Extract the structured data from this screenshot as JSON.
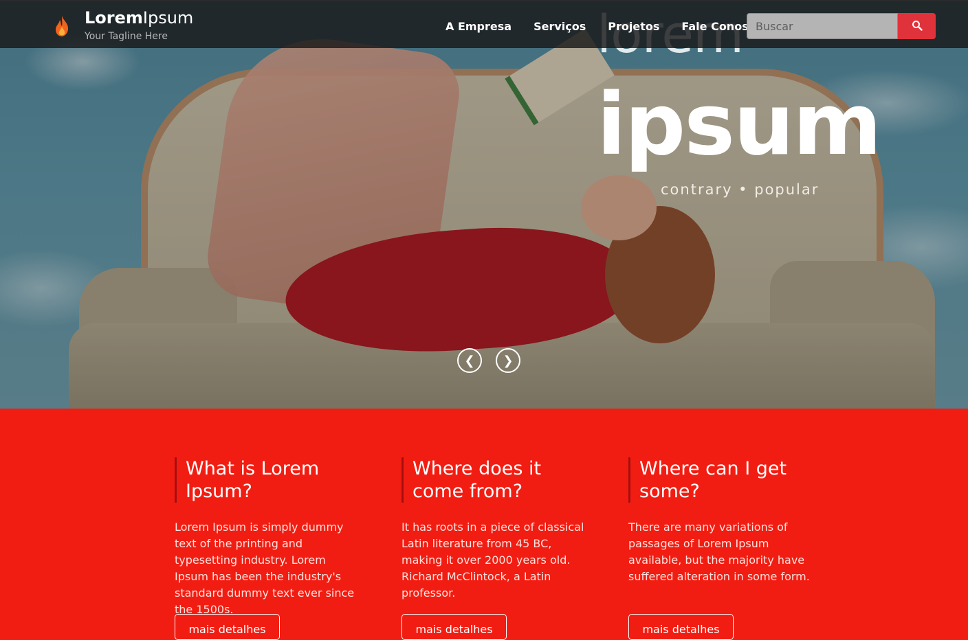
{
  "brand": {
    "bold": "Lorem",
    "light": "Ipsum",
    "tagline": "Your Tagline Here",
    "icon": "flame-icon"
  },
  "nav": {
    "items": [
      "A Empresa",
      "Serviços",
      "Projetos",
      "Fale Conosco"
    ]
  },
  "search": {
    "placeholder": "Buscar",
    "button_icon": "search-icon"
  },
  "hero": {
    "title_small": "lorem",
    "title_big": "ipsum",
    "subtitle": "contrary • popular",
    "prev_label": "❮",
    "next_label": "❯"
  },
  "features": [
    {
      "title": "What is Lorem Ipsum?",
      "text": "Lorem Ipsum is simply dummy text of the printing and typesetting industry. Lorem Ipsum has been the industry's standard dummy text ever since the 1500s.",
      "button": "mais detalhes"
    },
    {
      "title": "Where does it come from?",
      "text": "It has roots in a piece of classical Latin literature from 45 BC, making it over 2000 years old. Richard McClintock, a Latin professor.",
      "button": "mais detalhes"
    },
    {
      "title": "Where can I get some?",
      "text": "There are many variations of passages of Lorem Ipsum available, but the majority have suffered alteration in some form.",
      "button": "mais detalhes"
    }
  ],
  "colors": {
    "accent": "#e0323a",
    "section_bg": "#f21d12",
    "navbar_bg": "#181818"
  }
}
